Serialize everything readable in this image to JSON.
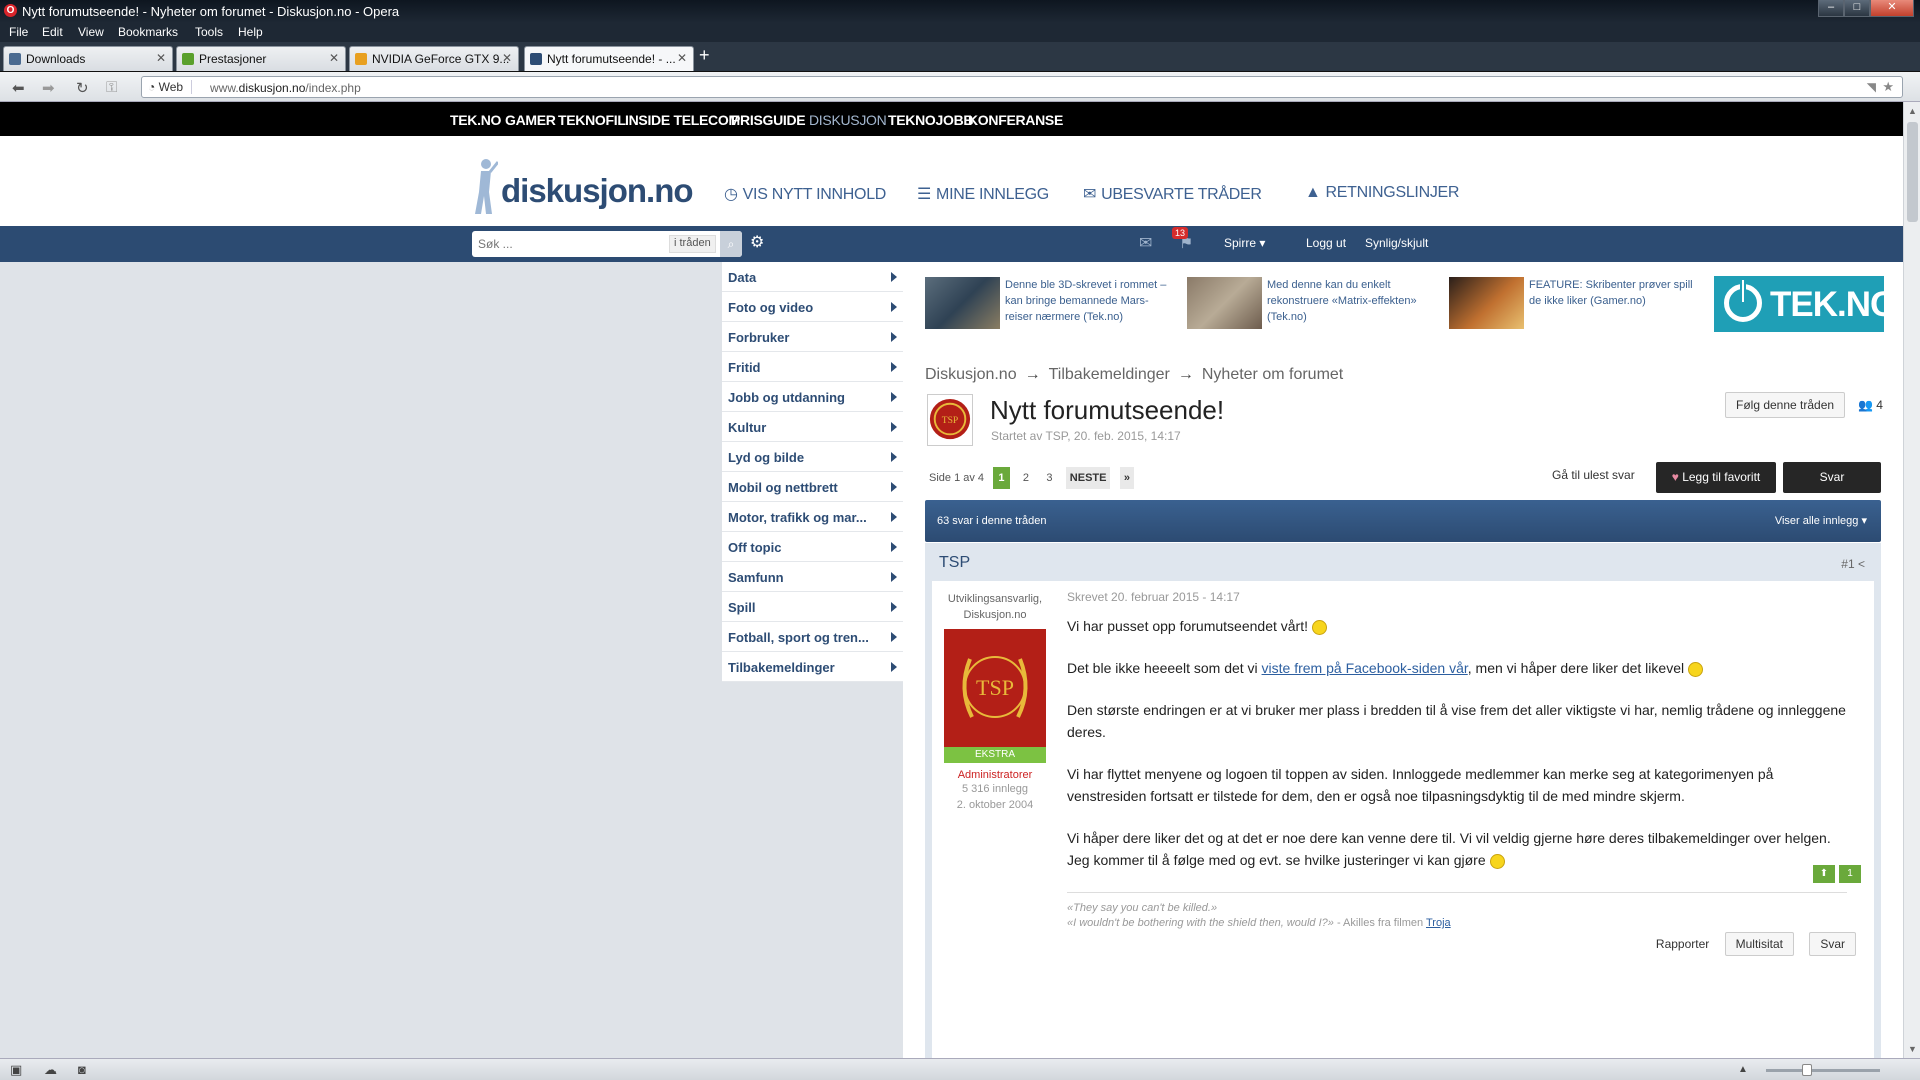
{
  "window": {
    "title": "Nytt forumutseende! - Nyheter om forumet - Diskusjon.no - Opera"
  },
  "menubar": [
    "File",
    "Edit",
    "View",
    "Bookmarks",
    "Tools",
    "Help"
  ],
  "tabs": [
    {
      "label": "Downloads",
      "favicon_color": "#4a6a90"
    },
    {
      "label": "Prestasjoner",
      "favicon_color": "#5aa02c"
    },
    {
      "label": "NVIDIA GeForce GTX 9...",
      "favicon_color": "#e8a020"
    },
    {
      "label": "Nytt forumutseende! - ...",
      "favicon_color": "#2d4c74"
    }
  ],
  "address": {
    "web_label": "Web",
    "url_prefix": "www.",
    "url_host": "diskusjon.no",
    "url_path": "/index.php"
  },
  "site_nav": [
    "TEK.NO",
    "GAMER",
    "TEKNOFIL",
    "INSIDE TELECOM",
    "PRISGUIDE",
    "DISKUSJON",
    "TEKNOJOBB",
    "KONFERANSE"
  ],
  "header": {
    "logo_text": "diskusjon.no",
    "nav": [
      "VIS NYTT INNHOLD",
      "MINE INNLEGG",
      "UBESVARTE TRÅDER",
      "RETNINGSLINJER"
    ]
  },
  "userbar": {
    "search_placeholder": "Søk ...",
    "search_scope": "i tråden",
    "notification_count": "13",
    "user_menu": "Spirre",
    "logout": "Logg ut",
    "visibility": "Synlig/skjult"
  },
  "categories": [
    "Data",
    "Foto og video",
    "Forbruker",
    "Fritid",
    "Jobb og utdanning",
    "Kultur",
    "Lyd og bilde",
    "Mobil og nettbrett",
    "Motor, trafikk og mar...",
    "Off topic",
    "Samfunn",
    "Spill",
    "Fotball, sport og tren...",
    "Tilbakemeldinger"
  ],
  "teasers": [
    {
      "title": "Denne ble 3D-skrevet i rommet – kan bringe bemannede Mars-reiser nærmere (Tek.no)"
    },
    {
      "title": "Med denne kan du enkelt rekonstruere «Matrix-effekten» (Tek.no)"
    },
    {
      "title": "FEATURE: Skribenter prøver spill de ikke liker (Gamer.no)"
    }
  ],
  "tekno_logo": "TEK.NO",
  "breadcrumb": [
    "Diskusjon.no",
    "Tilbakemeldinger",
    "Nyheter om forumet"
  ],
  "thread": {
    "title": "Nytt forumutseende!",
    "meta": "Startet av TSP, 20. feb. 2015, 14:17",
    "follow_label": "Følg denne tråden",
    "followers": "4",
    "page_info": "Side 1 av 4",
    "pages": [
      "1",
      "2",
      "3"
    ],
    "next_label": "NESTE",
    "last_label": "»",
    "unread_label": "Gå til ulest svar",
    "fav_label": "Legg til favoritt",
    "reply_label": "Svar",
    "reply_count": "63 svar i denne tråden",
    "view_label": "Viser alle innlegg"
  },
  "post": {
    "author": "TSP",
    "number": "#1",
    "role": "Utviklingsansvarlig, Diskusjon.no",
    "avatar_text": "TSP",
    "badge": "EKSTRA",
    "group": "Administratorer",
    "posts": "5 316 innlegg",
    "joined": "2. oktober 2004",
    "date": "Skrevet 20. februar 2015 - 14:17",
    "p1": "Vi har pusset opp forumutseendet vårt!",
    "p2_before": "Det ble ikke heeeelt som det vi ",
    "p2_link": "viste frem på Facebook-siden vår",
    "p2_after": ", men vi håper dere liker det likevel",
    "p3": "Den største endringen er at vi bruker mer plass i bredden til å vise frem det aller viktigste vi har, nemlig trådene og innleggene deres.",
    "p4": "Vi har flyttet menyene og logoen til toppen av siden. Innloggede medlemmer kan merke seg at kategorimenyen på venstresiden fortsatt er tilstede for dem, den er også noe tilpasningsdyktig til de med mindre skjerm.",
    "p5": "Vi håper dere liker det og at det er noe dere kan venne dere til. Vi vil veldig gjerne høre deres tilbakemeldinger over helgen. Jeg kommer til å følge med og evt. se hvilke justeringer vi kan gjøre",
    "like_count": "1",
    "sig_line1": "«They say you can't be killed.»",
    "sig_line2": "«I wouldn't be bothering with the shield then, would I?»",
    "sig_attr": " - Akilles fra filmen ",
    "sig_link": "Troja",
    "report": "Rapporter",
    "multiquote": "Multisitat",
    "reply": "Svar"
  }
}
